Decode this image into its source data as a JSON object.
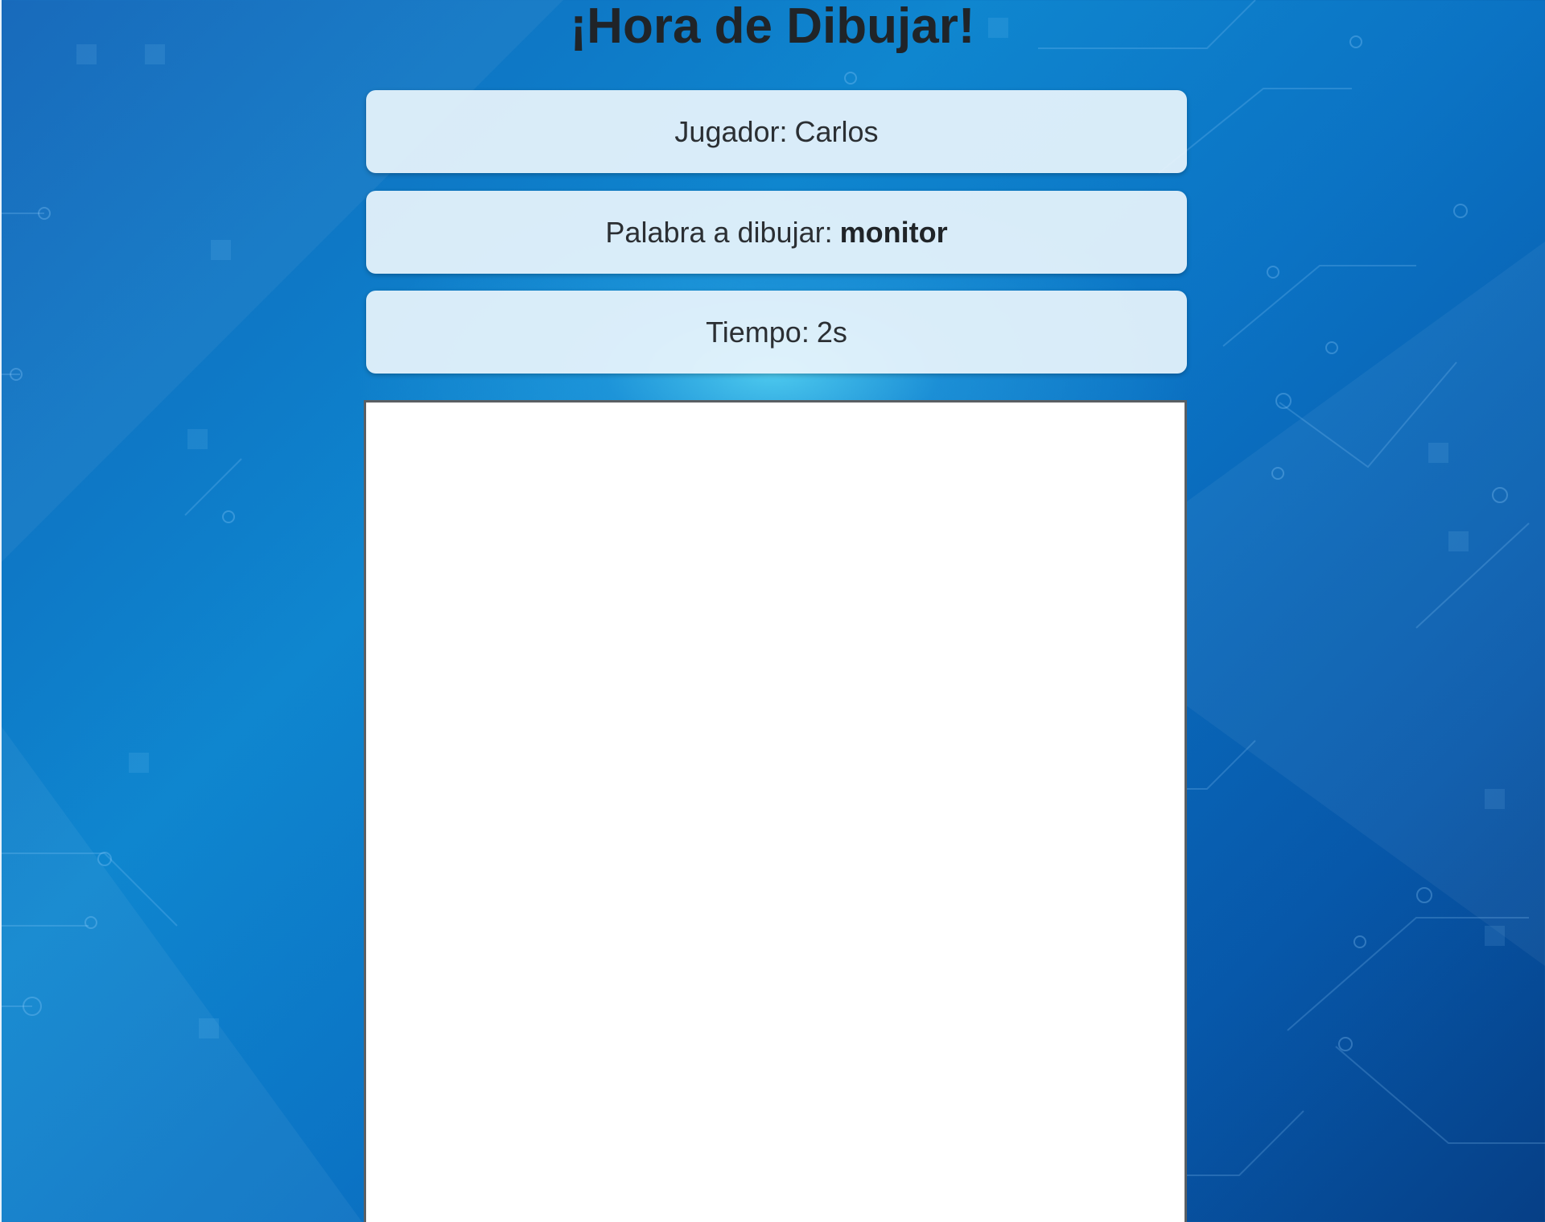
{
  "page": {
    "title": "¡Hora de Dibujar!"
  },
  "player": {
    "label": "Jugador:",
    "name": "Carlos"
  },
  "word": {
    "label": "Palabra a dibujar:",
    "value": "monitor"
  },
  "timer": {
    "label": "Tiempo:",
    "value": "2s"
  },
  "colors": {
    "background_primary": "#0b73c4",
    "background_glow": "#50cdf0",
    "panel_background": "#e8f4fc",
    "text": "#202428",
    "canvas_background": "#ffffff",
    "canvas_border": "#5a5f63"
  },
  "icons": [
    "circuit-board-background"
  ]
}
